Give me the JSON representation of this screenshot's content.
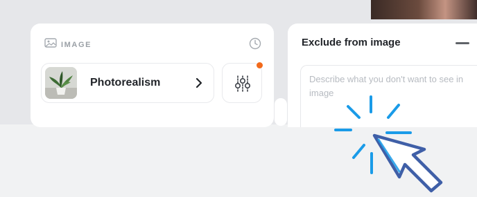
{
  "image_panel": {
    "label": "IMAGE",
    "style": {
      "name": "Photorealism"
    }
  },
  "exclude_panel": {
    "title": "Exclude from image",
    "placeholder": "Describe what you don't want to see in image"
  },
  "icons": {
    "image": "image-icon",
    "history": "clock-icon",
    "chevron": "chevron-right-icon",
    "settings": "sliders-icon",
    "collapse": "minus-icon",
    "pointer": "cursor-click-icon"
  },
  "colors": {
    "notification_dot": "#f26a1b",
    "cursor_accent": "#1a9be8",
    "cursor_outline": "#3f5fa7"
  }
}
